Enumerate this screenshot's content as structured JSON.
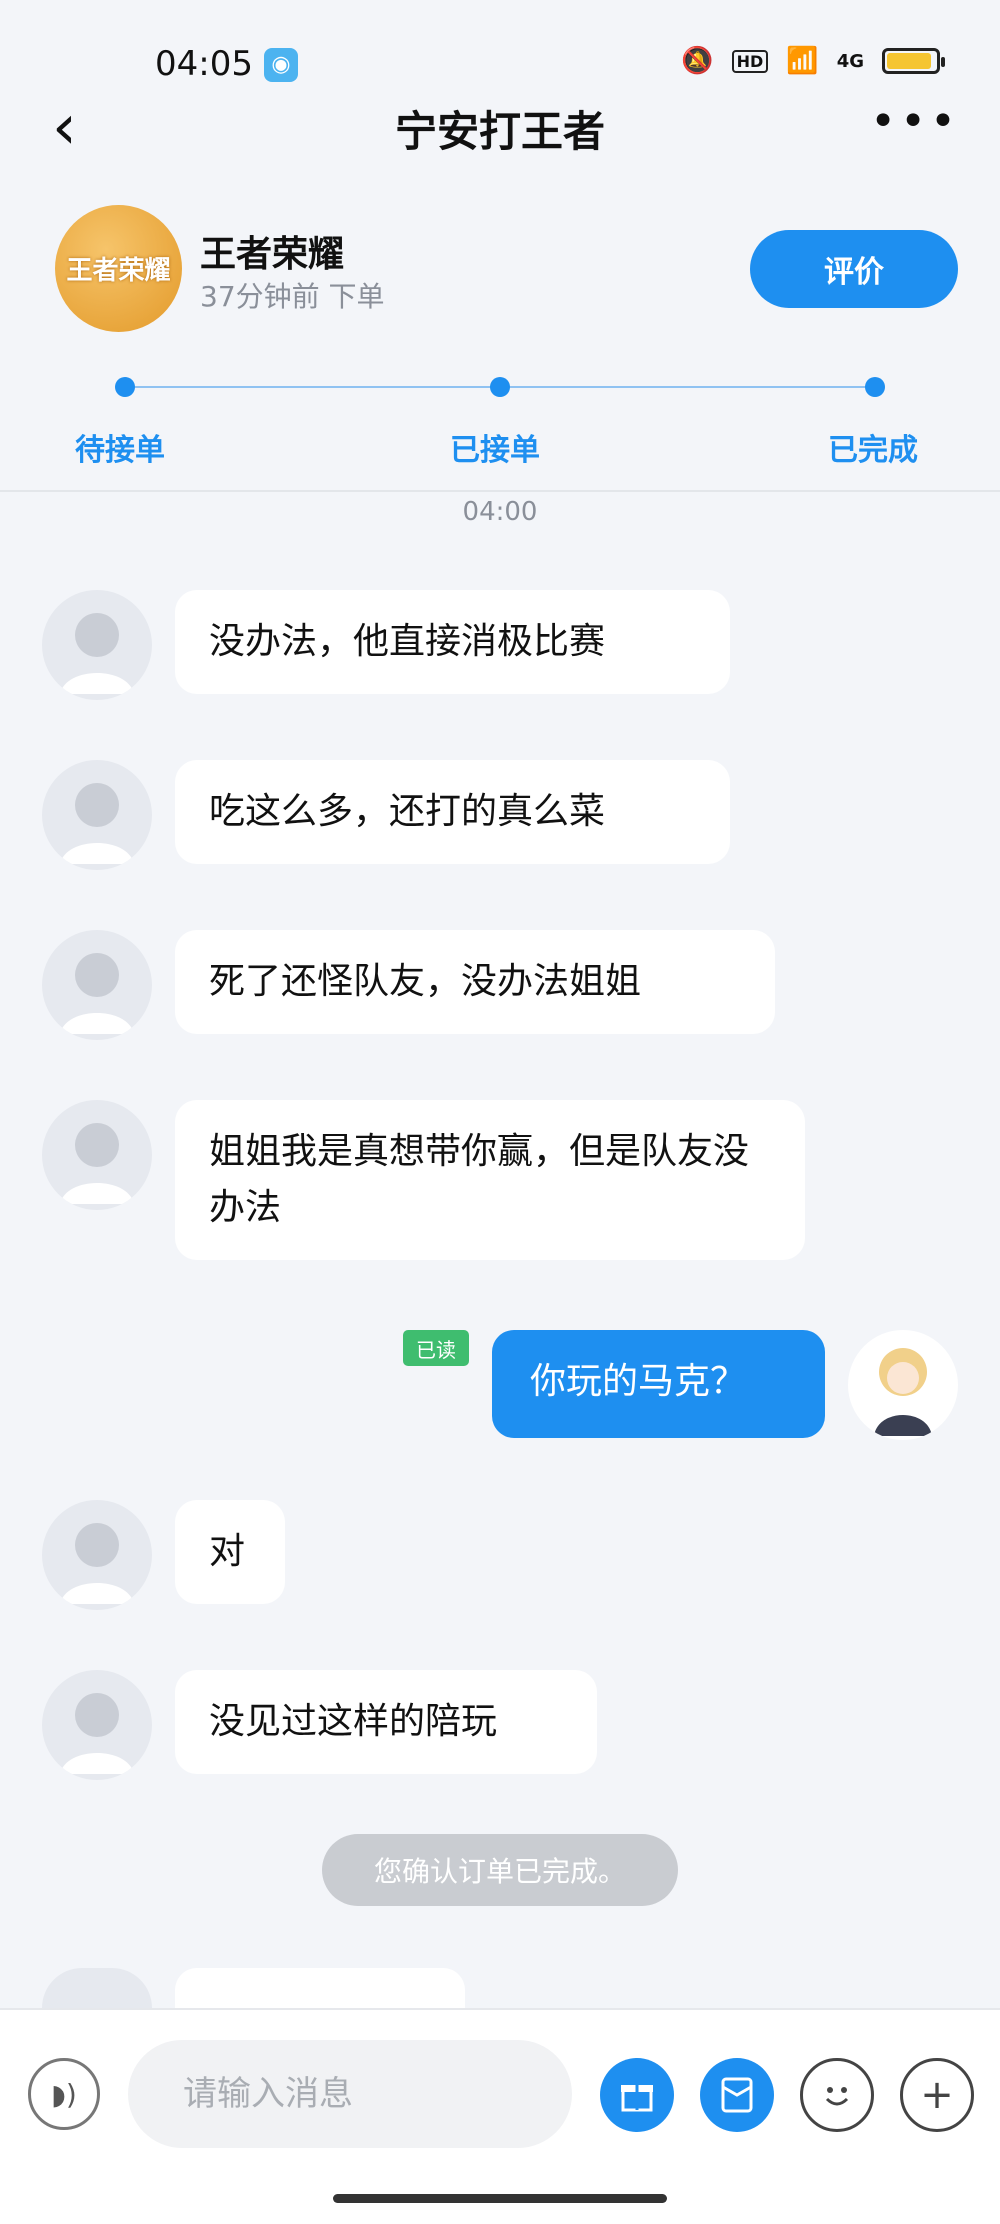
{
  "status_bar": {
    "time": "04:05",
    "network": "4G",
    "hd": "HD",
    "battery_level": 0.85
  },
  "nav": {
    "title": "宁安打王者"
  },
  "order": {
    "game_logo_text": "王者荣耀",
    "game_name": "王者荣耀",
    "time_label": "37分钟前 下单",
    "rate_button": "评价",
    "steps": [
      "待接单",
      "已接单",
      "已完成"
    ]
  },
  "timestamp": "04:00",
  "messages": [
    {
      "from": "other",
      "text": "没办法，他直接消极比赛"
    },
    {
      "from": "other",
      "text": "吃这么多，还打的真么菜"
    },
    {
      "from": "other",
      "text": "死了还怪队友，没办法姐姐"
    },
    {
      "from": "other",
      "text": "姐姐我是真想带你赢，但是队友没办法"
    },
    {
      "from": "me",
      "text": "你玩的马克？",
      "tag": "已读"
    },
    {
      "from": "other",
      "text": "对"
    },
    {
      "from": "other",
      "text": "没见过这样的陪玩"
    }
  ],
  "system_notice": "您确认订单已完成。",
  "input": {
    "placeholder": "请输入消息"
  },
  "colors": {
    "accent": "#1e8ff0",
    "read_tag": "#3fbd6f",
    "background": "#f3f5f9"
  }
}
